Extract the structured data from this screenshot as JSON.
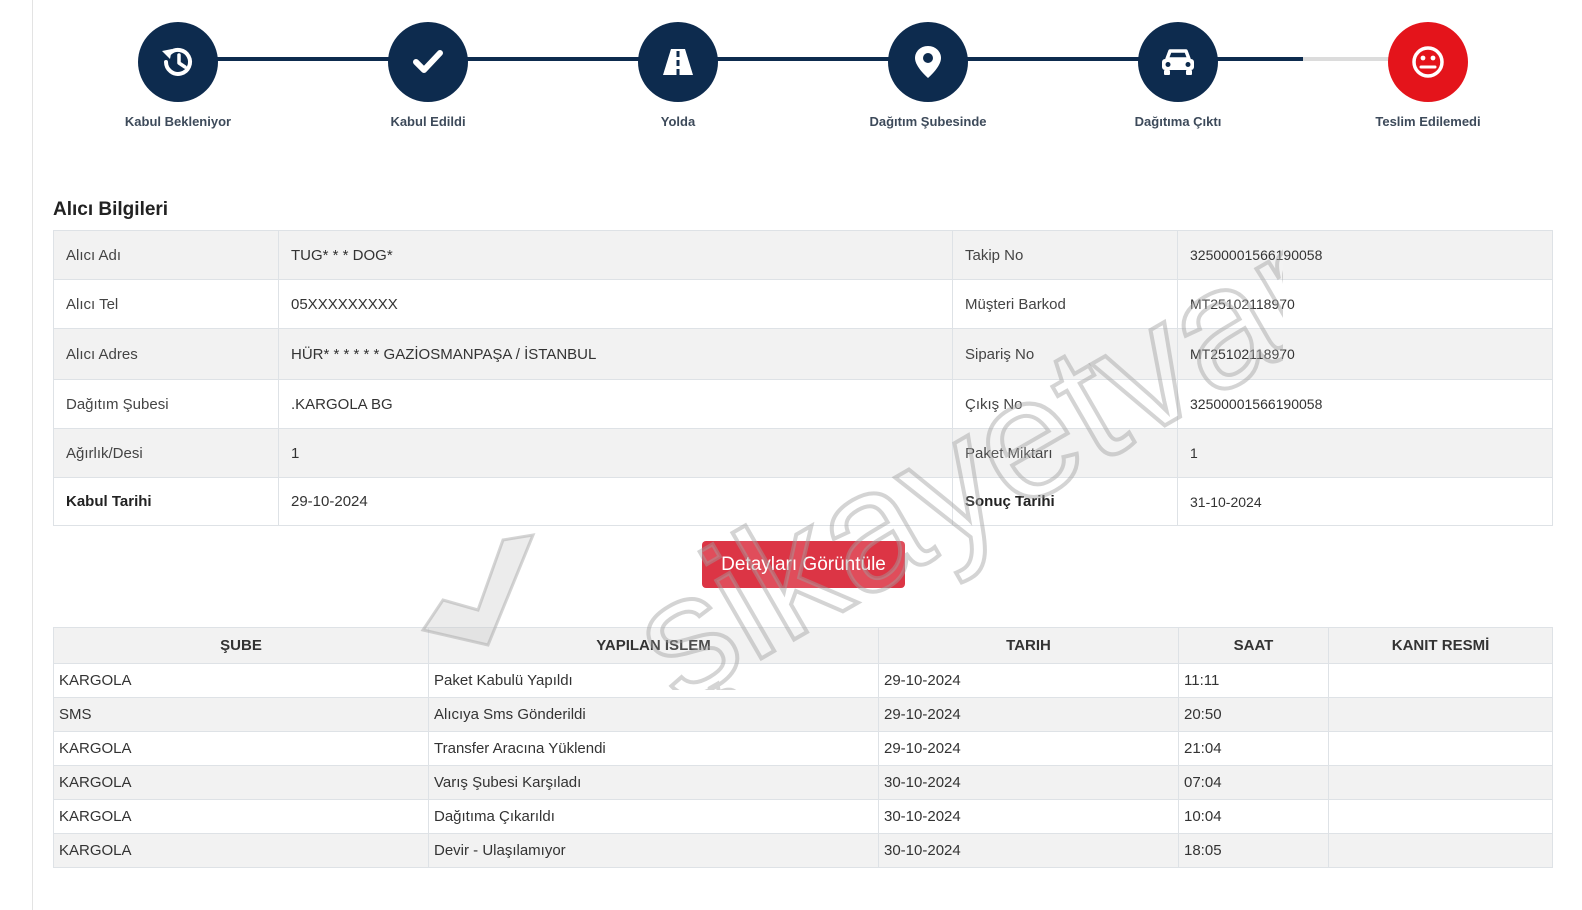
{
  "tracker": {
    "steps": [
      {
        "label": "Kabul Bekleniyor",
        "icon": "history-icon"
      },
      {
        "label": "Kabul Edildi",
        "icon": "check-icon"
      },
      {
        "label": "Yolda",
        "icon": "road-icon"
      },
      {
        "label": "Dağıtım Şubesinde",
        "icon": "map-pin-icon"
      },
      {
        "label": "Dağıtıma Çıktı",
        "icon": "car-icon"
      },
      {
        "label": "Teslim Edilemedi",
        "icon": "sad-face-icon"
      }
    ],
    "colors": {
      "active": "#0d2b4e",
      "failed": "#e4141b",
      "pending_line": "#dcdcdc"
    }
  },
  "recipient": {
    "title": "Alıcı Bilgileri",
    "rows": [
      {
        "k1": "Alıcı Adı",
        "v1": "TUG* * * DOG*",
        "k2": "Takip No",
        "v2": "32500001566190058"
      },
      {
        "k1": "Alıcı Tel",
        "v1": "05XXXXXXXXX",
        "k2": "Müşteri Barkod",
        "v2": "MT25102118970"
      },
      {
        "k1": "Alıcı Adres",
        "v1": "HÜR* * * * * * GAZİOSMANPAŞA / İSTANBUL",
        "k2": "Sipariş No",
        "v2": "MT25102118970"
      },
      {
        "k1": "Dağıtım Şubesi",
        "v1": ".KARGOLA BG",
        "k2": "Çıkış No",
        "v2": "32500001566190058"
      },
      {
        "k1": "Ağırlık/Desi",
        "v1": "1",
        "k2": "Paket Miktarı",
        "v2": "1"
      },
      {
        "k1": "Kabul Tarihi",
        "v1": "29-10-2024",
        "k2": "Sonuç Tarihi",
        "v2": "31-10-2024"
      }
    ]
  },
  "details_button": "Detayları Görüntüle",
  "history": {
    "headers": [
      "ŞUBE",
      "YAPILAN ISLEM",
      "TARIH",
      "SAAT",
      "KANIT RESMİ"
    ],
    "rows": [
      [
        "KARGOLA",
        "Paket Kabulü Yapıldı",
        "29-10-2024",
        "11:11",
        ""
      ],
      [
        "SMS",
        "Alıcıya Sms Gönderildi",
        "29-10-2024",
        "20:50",
        ""
      ],
      [
        "KARGOLA",
        "Transfer Aracına Yüklendi",
        "29-10-2024",
        "21:04",
        ""
      ],
      [
        "KARGOLA",
        "Varış Şubesi Karşıladı",
        "30-10-2024",
        "07:04",
        ""
      ],
      [
        "KARGOLA",
        "Dağıtıma Çıkarıldı",
        "30-10-2024",
        "10:04",
        ""
      ],
      [
        "KARGOLA",
        "Devir - Ulaşılamıyor",
        "30-10-2024",
        "18:05",
        ""
      ]
    ]
  },
  "watermark": {
    "text": "şikayetvar"
  }
}
